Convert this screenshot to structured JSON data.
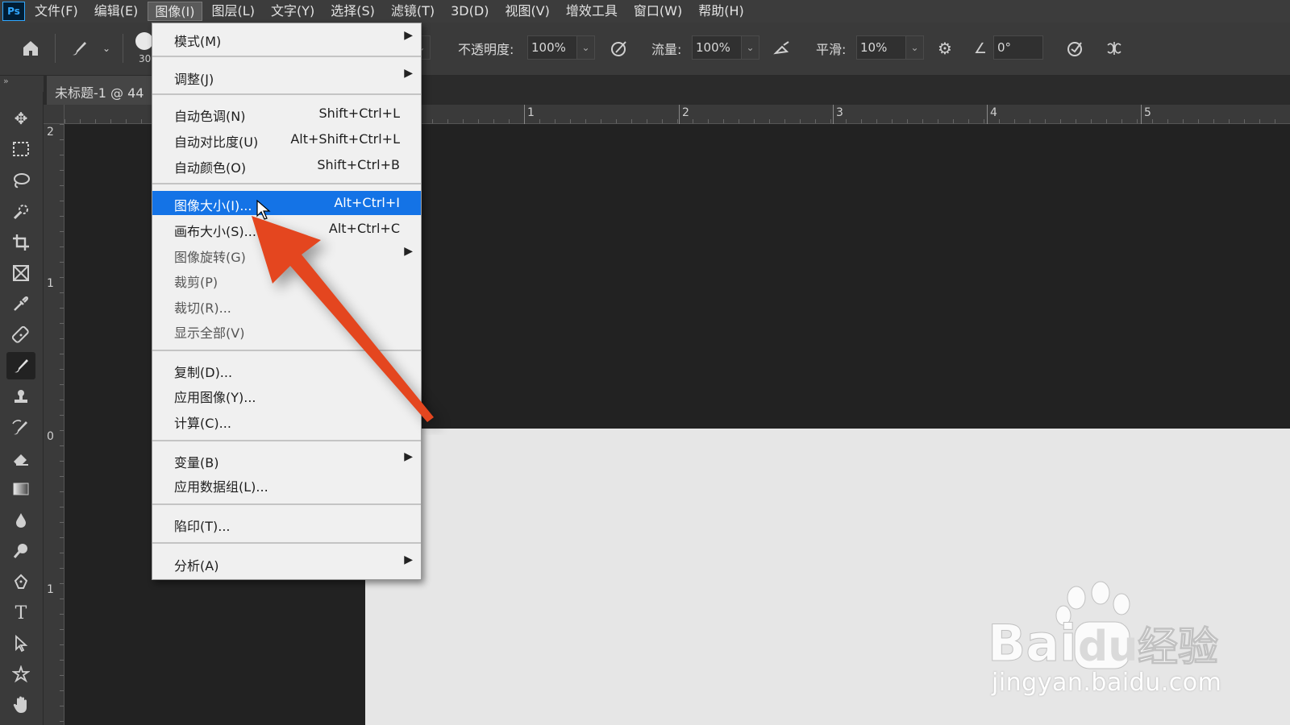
{
  "app": {
    "logo_text": "Ps"
  },
  "menubar": {
    "items": [
      {
        "label": "文件(F)"
      },
      {
        "label": "编辑(E)"
      },
      {
        "label": "图像(I)",
        "active": true
      },
      {
        "label": "图层(L)"
      },
      {
        "label": "文字(Y)"
      },
      {
        "label": "选择(S)"
      },
      {
        "label": "滤镜(T)"
      },
      {
        "label": "3D(D)"
      },
      {
        "label": "视图(V)"
      },
      {
        "label": "增效工具"
      },
      {
        "label": "窗口(W)"
      },
      {
        "label": "帮助(H)"
      }
    ]
  },
  "options": {
    "brush_size": "30",
    "opacity_label": "不透明度:",
    "opacity_value": "100%",
    "flow_label": "流量:",
    "flow_value": "100%",
    "smoothing_label": "平滑:",
    "smoothing_value": "10%",
    "angle_value": "0°"
  },
  "toolbar": {
    "collapse": "»",
    "tools": [
      {
        "name": "move-tool",
        "icon": "move-icon"
      },
      {
        "name": "marquee-tool",
        "icon": "marquee-icon"
      },
      {
        "name": "lasso-tool",
        "icon": "lasso-icon"
      },
      {
        "name": "quick-select-tool",
        "icon": "quick-select-icon"
      },
      {
        "name": "crop-tool",
        "icon": "crop-icon"
      },
      {
        "name": "frame-tool",
        "icon": "frame-icon"
      },
      {
        "name": "eyedropper-tool",
        "icon": "eyedropper-icon"
      },
      {
        "name": "healing-tool",
        "icon": "bandage-icon"
      },
      {
        "name": "brush-tool",
        "icon": "brush-icon",
        "selected": true
      },
      {
        "name": "stamp-tool",
        "icon": "stamp-icon"
      },
      {
        "name": "history-brush-tool",
        "icon": "history-brush-icon"
      },
      {
        "name": "eraser-tool",
        "icon": "eraser-icon"
      },
      {
        "name": "gradient-tool",
        "icon": "gradient-icon"
      },
      {
        "name": "blur-tool",
        "icon": "drop-icon"
      },
      {
        "name": "dodge-tool",
        "icon": "dodge-icon"
      },
      {
        "name": "pen-tool",
        "icon": "pen-icon"
      },
      {
        "name": "type-tool",
        "icon": "type-icon"
      },
      {
        "name": "path-select-tool",
        "icon": "arrow-select-icon"
      },
      {
        "name": "custom-shape-tool",
        "icon": "shape-icon"
      },
      {
        "name": "hand-tool",
        "icon": "hand-icon"
      }
    ]
  },
  "document": {
    "tab_title": "未标题-1 @ 44"
  },
  "rulers": {
    "top_labels": [
      "1",
      "2",
      "3",
      "4",
      "5"
    ],
    "left_labels": [
      "2",
      "1",
      "0",
      "1"
    ]
  },
  "image_menu": {
    "mode": {
      "label": "模式(M)"
    },
    "adjust": {
      "label": "调整(J)"
    },
    "auto_tone": {
      "label": "自动色调(N)",
      "shortcut": "Shift+Ctrl+L"
    },
    "auto_contrast": {
      "label": "自动对比度(U)",
      "shortcut": "Alt+Shift+Ctrl+L"
    },
    "auto_color": {
      "label": "自动颜色(O)",
      "shortcut": "Shift+Ctrl+B"
    },
    "image_size": {
      "label": "图像大小(I)...",
      "shortcut": "Alt+Ctrl+I"
    },
    "canvas_size": {
      "label": "画布大小(S)...",
      "shortcut": "Alt+Ctrl+C"
    },
    "image_rotation": {
      "label": "图像旋转(G)"
    },
    "crop": {
      "label": "裁剪(P)"
    },
    "trim": {
      "label": "裁切(R)..."
    },
    "reveal_all": {
      "label": "显示全部(V)"
    },
    "duplicate": {
      "label": "复制(D)..."
    },
    "apply_image": {
      "label": "应用图像(Y)..."
    },
    "calculations": {
      "label": "计算(C)..."
    },
    "variables": {
      "label": "变量(B)"
    },
    "apply_data_set": {
      "label": "应用数据组(L)..."
    },
    "trap": {
      "label": "陷印(T)..."
    },
    "analysis": {
      "label": "分析(A)"
    }
  },
  "annotation": {
    "arrow_color": "#e4461f"
  },
  "watermark": {
    "text": "Baidu经验",
    "url": "jingyan.baidu.com"
  },
  "colors": {
    "highlight": "#1473e6",
    "menu_bg": "#f0f0f0",
    "ui_dark": "#3a3a3a"
  }
}
